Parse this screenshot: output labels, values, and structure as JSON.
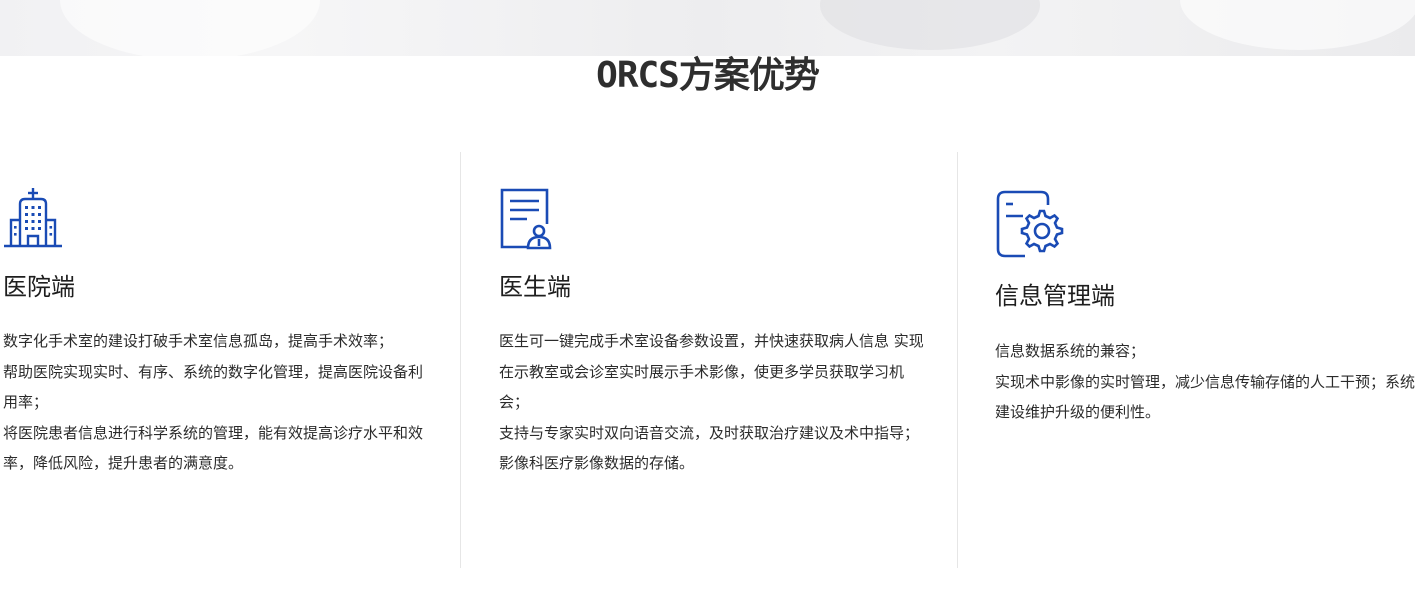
{
  "section": {
    "title": "ORCS方案优势"
  },
  "colors": {
    "icon_blue": "#1a4bb5",
    "text_dark": "#222222",
    "divider": "#e6e6e6"
  },
  "cards": [
    {
      "icon": "hospital-icon",
      "title": "医院端",
      "lines": [
        "数字化手术室的建设打破手术室信息孤岛，提高手术效率；",
        "帮助医院实现实时、有序、系统的数字化管理，提高医院设备利用率；",
        "将医院患者信息进行科学系统的管理，能有效提高诊疗水平和效率，降低风险，提升患者的满意度。"
      ]
    },
    {
      "icon": "doctor-document-icon",
      "title": "医生端",
      "lines": [
        "医生可一键完成手术室设备参数设置，并快速获取病人信息 实现在示教室或会诊室实时展示手术影像，使更多学员获取学习机会；",
        "支持与专家实时双向语音交流，及时获取治疗建议及术中指导；",
        "影像科医疗影像数据的存储。"
      ]
    },
    {
      "icon": "settings-document-icon",
      "title": "信息管理端",
      "lines": [
        "信息数据系统的兼容；",
        "实现术中影像的实时管理，减少信息传输存储的人工干预；系统建设维护升级的便利性。"
      ]
    }
  ]
}
